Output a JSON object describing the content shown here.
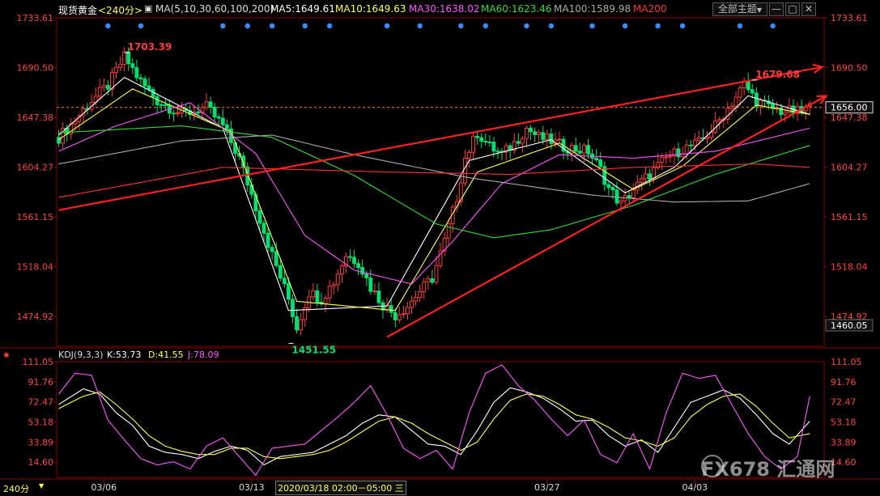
{
  "header": {
    "symbol": "现货黄金",
    "period": "<240分>",
    "ma_label": "MA(5,10,30,60,100,200)",
    "ma5": "MA5:1649.61",
    "ma10": "MA10:1649.63",
    "ma30": "MA30:1638.02",
    "ma60": "MA60:1623.46",
    "ma100": "MA100:1589.98",
    "ma200": "MA200",
    "theme_button": "全部主题",
    "theme_arrow": "▼",
    "win_min": "—",
    "win_max": "□",
    "win_close": "✕"
  },
  "kdj": {
    "label": "KDJ(9,3,3)",
    "k": "K:53.73",
    "d": "D:41.55",
    "j": "J:78.09"
  },
  "bottom": {
    "period": "240分",
    "cursor_time": "2020/03/18 02:00－05:00 三"
  },
  "watermark": "FX678 汇通网",
  "colors": {
    "up": "#ff3c3c",
    "down": "#00e070",
    "ma5": "#ffffff",
    "ma10": "#ffff55",
    "ma30": "#ff55ff",
    "ma60": "#33dd33",
    "ma100": "#aaaaaa",
    "ma200": "#ff3333",
    "trend": "#ff2020",
    "grid": "#8b0000",
    "axis_text": "#ff4444"
  },
  "chart_data": {
    "type": "candlestick",
    "y_axis": {
      "ticks": [
        1733.61,
        1690.5,
        1647.38,
        1604.27,
        1561.15,
        1518.04,
        1474.92
      ],
      "tick_labels": [
        "1733.61",
        "1690.50",
        "1647.38",
        "1604.27",
        "1561.15",
        "1518.04",
        "1474.92"
      ],
      "range": [
        1449,
        1733.61
      ],
      "current_price": 1656.0,
      "current_label": "1656.00",
      "bottom_label": "1460.05"
    },
    "x_axis": {
      "labels": [
        "03/06",
        "03/13",
        "03/27",
        "04/03"
      ],
      "label_bar_index": [
        11,
        47,
        119,
        155
      ]
    },
    "annotations": [
      {
        "text": "1703.39",
        "bar": 16,
        "value": 1703.39,
        "kind": "high"
      },
      {
        "text": "1451.55",
        "bar": 56,
        "value": 1451.55,
        "kind": "low"
      },
      {
        "text": "1679.68",
        "bar": 169,
        "value": 1679.68,
        "kind": "high"
      }
    ],
    "price_path": [
      [
        0,
        1630
      ],
      [
        4,
        1645
      ],
      [
        8,
        1662
      ],
      [
        12,
        1675
      ],
      [
        16,
        1700
      ],
      [
        20,
        1678
      ],
      [
        24,
        1662
      ],
      [
        30,
        1650
      ],
      [
        36,
        1656
      ],
      [
        40,
        1640
      ],
      [
        44,
        1612
      ],
      [
        48,
        1570
      ],
      [
        52,
        1528
      ],
      [
        56,
        1490
      ],
      [
        58,
        1465
      ],
      [
        61,
        1496
      ],
      [
        64,
        1490
      ],
      [
        67,
        1505
      ],
      [
        70,
        1528
      ],
      [
        73,
        1522
      ],
      [
        76,
        1500
      ],
      [
        79,
        1485
      ],
      [
        82,
        1476
      ],
      [
        85,
        1484
      ],
      [
        88,
        1497
      ],
      [
        91,
        1508
      ],
      [
        94,
        1540
      ],
      [
        97,
        1578
      ],
      [
        99,
        1612
      ],
      [
        102,
        1634
      ],
      [
        105,
        1622
      ],
      [
        108,
        1615
      ],
      [
        111,
        1625
      ],
      [
        114,
        1638
      ],
      [
        117,
        1630
      ],
      [
        120,
        1627
      ],
      [
        123,
        1622
      ],
      [
        126,
        1620
      ],
      [
        129,
        1618
      ],
      [
        132,
        1602
      ],
      [
        134,
        1586
      ],
      [
        137,
        1572
      ],
      [
        140,
        1585
      ],
      [
        144,
        1598
      ],
      [
        148,
        1612
      ],
      [
        152,
        1620
      ],
      [
        156,
        1625
      ],
      [
        160,
        1640
      ],
      [
        164,
        1660
      ],
      [
        167,
        1676
      ],
      [
        170,
        1662
      ],
      [
        173,
        1656
      ],
      [
        176,
        1653
      ],
      [
        180,
        1652
      ],
      [
        183,
        1656
      ]
    ],
    "series": [
      {
        "name": "MA5",
        "values": [
          [
            0,
            1632
          ],
          [
            16,
            1682
          ],
          [
            40,
            1638
          ],
          [
            56,
            1480
          ],
          [
            80,
            1484
          ],
          [
            100,
            1610
          ],
          [
            120,
            1628
          ],
          [
            138,
            1582
          ],
          [
            150,
            1604
          ],
          [
            168,
            1666
          ],
          [
            183,
            1650
          ]
        ]
      },
      {
        "name": "MA10",
        "values": [
          [
            0,
            1628
          ],
          [
            18,
            1672
          ],
          [
            42,
            1635
          ],
          [
            58,
            1488
          ],
          [
            82,
            1480
          ],
          [
            102,
            1600
          ],
          [
            122,
            1625
          ],
          [
            140,
            1585
          ],
          [
            152,
            1605
          ],
          [
            170,
            1658
          ],
          [
            183,
            1650
          ]
        ]
      },
      {
        "name": "MA30",
        "values": [
          [
            0,
            1618
          ],
          [
            14,
            1640
          ],
          [
            32,
            1660
          ],
          [
            48,
            1616
          ],
          [
            60,
            1545
          ],
          [
            72,
            1515
          ],
          [
            86,
            1503
          ],
          [
            96,
            1540
          ],
          [
            108,
            1590
          ],
          [
            122,
            1615
          ],
          [
            140,
            1612
          ],
          [
            160,
            1618
          ],
          [
            183,
            1638
          ]
        ]
      },
      {
        "name": "MA60",
        "values": [
          [
            0,
            1634
          ],
          [
            30,
            1640
          ],
          [
            52,
            1630
          ],
          [
            72,
            1597
          ],
          [
            92,
            1555
          ],
          [
            106,
            1543
          ],
          [
            120,
            1550
          ],
          [
            140,
            1571
          ],
          [
            160,
            1598
          ],
          [
            183,
            1623
          ]
        ]
      },
      {
        "name": "MA100",
        "values": [
          [
            0,
            1607
          ],
          [
            30,
            1627
          ],
          [
            52,
            1632
          ],
          [
            72,
            1615
          ],
          [
            100,
            1595
          ],
          [
            130,
            1580
          ],
          [
            150,
            1574
          ],
          [
            168,
            1575
          ],
          [
            183,
            1590
          ]
        ]
      },
      {
        "name": "MA200",
        "values": [
          [
            0,
            1578
          ],
          [
            40,
            1604
          ],
          [
            80,
            1600
          ],
          [
            110,
            1598
          ],
          [
            140,
            1604
          ],
          [
            170,
            1607
          ],
          [
            183,
            1604
          ]
        ]
      }
    ],
    "trendlines": [
      {
        "from": [
          0,
          1567
        ],
        "to": [
          186,
          1691
        ],
        "arrow": true
      },
      {
        "from": [
          80,
          1457
        ],
        "to": [
          187,
          1666
        ],
        "arrow": true
      }
    ],
    "signal_dots_bars": [
      12,
      20,
      40,
      46,
      52,
      60,
      66,
      80,
      88,
      98,
      104,
      114,
      120,
      130,
      138,
      146,
      152,
      166,
      174
    ],
    "kdj_axis": {
      "ticks": [
        111.05,
        91.76,
        72.47,
        53.18,
        33.89,
        14.6
      ],
      "tick_labels": [
        "111.05",
        "91.76",
        "72.47",
        "53.18",
        "33.89",
        "14.60"
      ],
      "range": [
        0,
        111.05
      ]
    },
    "kdj_series": [
      {
        "name": "K",
        "values": [
          [
            0,
            70
          ],
          [
            6,
            85
          ],
          [
            10,
            80
          ],
          [
            14,
            62
          ],
          [
            18,
            50
          ],
          [
            22,
            30
          ],
          [
            26,
            24
          ],
          [
            30,
            22
          ],
          [
            34,
            18
          ],
          [
            38,
            25
          ],
          [
            42,
            30
          ],
          [
            46,
            26
          ],
          [
            50,
            12
          ],
          [
            54,
            20
          ],
          [
            58,
            22
          ],
          [
            62,
            24
          ],
          [
            66,
            32
          ],
          [
            70,
            40
          ],
          [
            74,
            52
          ],
          [
            78,
            60
          ],
          [
            82,
            58
          ],
          [
            86,
            45
          ],
          [
            90,
            32
          ],
          [
            94,
            30
          ],
          [
            98,
            22
          ],
          [
            102,
            45
          ],
          [
            106,
            72
          ],
          [
            110,
            86
          ],
          [
            114,
            82
          ],
          [
            118,
            76
          ],
          [
            122,
            66
          ],
          [
            126,
            54
          ],
          [
            130,
            55
          ],
          [
            134,
            40
          ],
          [
            138,
            30
          ],
          [
            142,
            36
          ],
          [
            146,
            24
          ],
          [
            150,
            48
          ],
          [
            154,
            72
          ],
          [
            158,
            78
          ],
          [
            162,
            84
          ],
          [
            166,
            76
          ],
          [
            170,
            60
          ],
          [
            174,
            42
          ],
          [
            178,
            32
          ],
          [
            183,
            54
          ]
        ]
      },
      {
        "name": "D",
        "values": [
          [
            0,
            66
          ],
          [
            6,
            78
          ],
          [
            10,
            82
          ],
          [
            14,
            70
          ],
          [
            18,
            56
          ],
          [
            22,
            40
          ],
          [
            26,
            30
          ],
          [
            30,
            25
          ],
          [
            34,
            22
          ],
          [
            38,
            22
          ],
          [
            42,
            28
          ],
          [
            46,
            28
          ],
          [
            50,
            20
          ],
          [
            54,
            18
          ],
          [
            58,
            20
          ],
          [
            62,
            22
          ],
          [
            66,
            26
          ],
          [
            70,
            34
          ],
          [
            74,
            44
          ],
          [
            78,
            54
          ],
          [
            82,
            58
          ],
          [
            86,
            52
          ],
          [
            90,
            42
          ],
          [
            94,
            34
          ],
          [
            98,
            26
          ],
          [
            102,
            34
          ],
          [
            106,
            56
          ],
          [
            110,
            74
          ],
          [
            114,
            80
          ],
          [
            118,
            78
          ],
          [
            122,
            70
          ],
          [
            126,
            60
          ],
          [
            130,
            56
          ],
          [
            134,
            48
          ],
          [
            138,
            38
          ],
          [
            142,
            35
          ],
          [
            146,
            30
          ],
          [
            150,
            38
          ],
          [
            154,
            58
          ],
          [
            158,
            70
          ],
          [
            162,
            78
          ],
          [
            166,
            80
          ],
          [
            170,
            68
          ],
          [
            174,
            52
          ],
          [
            178,
            38
          ],
          [
            183,
            42
          ]
        ]
      },
      {
        "name": "J",
        "values": [
          [
            0,
            80
          ],
          [
            4,
            100
          ],
          [
            8,
            98
          ],
          [
            12,
            55
          ],
          [
            16,
            36
          ],
          [
            20,
            18
          ],
          [
            24,
            12
          ],
          [
            28,
            15
          ],
          [
            32,
            8
          ],
          [
            36,
            30
          ],
          [
            40,
            38
          ],
          [
            44,
            20
          ],
          [
            48,
            2
          ],
          [
            52,
            28
          ],
          [
            56,
            30
          ],
          [
            60,
            32
          ],
          [
            64,
            45
          ],
          [
            68,
            58
          ],
          [
            72,
            72
          ],
          [
            76,
            88
          ],
          [
            80,
            60
          ],
          [
            84,
            28
          ],
          [
            88,
            18
          ],
          [
            92,
            26
          ],
          [
            96,
            8
          ],
          [
            100,
            62
          ],
          [
            104,
            100
          ],
          [
            108,
            108
          ],
          [
            112,
            88
          ],
          [
            116,
            74
          ],
          [
            120,
            56
          ],
          [
            124,
            40
          ],
          [
            128,
            55
          ],
          [
            132,
            22
          ],
          [
            136,
            14
          ],
          [
            140,
            42
          ],
          [
            144,
            8
          ],
          [
            148,
            62
          ],
          [
            152,
            100
          ],
          [
            156,
            95
          ],
          [
            160,
            98
          ],
          [
            164,
            70
          ],
          [
            168,
            42
          ],
          [
            172,
            20
          ],
          [
            176,
            8
          ],
          [
            180,
            20
          ],
          [
            183,
            78
          ]
        ]
      }
    ]
  }
}
